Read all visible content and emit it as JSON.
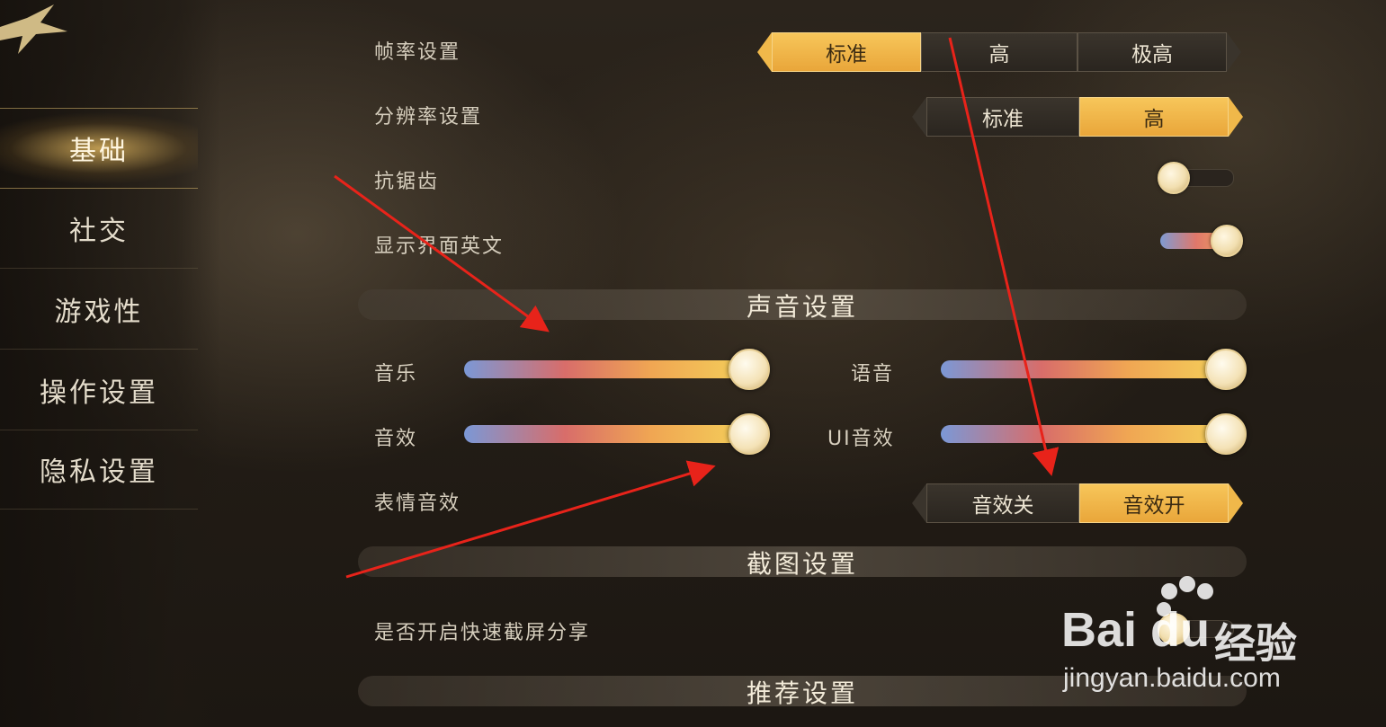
{
  "sidebar": {
    "items": [
      {
        "label": "基础"
      },
      {
        "label": "社交"
      },
      {
        "label": "游戏性"
      },
      {
        "label": "操作设置"
      },
      {
        "label": "隐私设置"
      }
    ],
    "active_index": 0
  },
  "graphics": {
    "frame_rate": {
      "label": "帧率设置",
      "options": [
        "标准",
        "高",
        "极高"
      ],
      "selected": "标准"
    },
    "resolution": {
      "label": "分辨率设置",
      "options": [
        "标准",
        "高"
      ],
      "selected": "高"
    },
    "antialiasing": {
      "label": "抗锯齿",
      "enabled": false
    },
    "show_english_ui": {
      "label": "显示界面英文",
      "enabled": true
    }
  },
  "sound": {
    "section_title": "声音设置",
    "music": {
      "label": "音乐",
      "level": 1.0
    },
    "voice": {
      "label": "语音",
      "level": 1.0
    },
    "sfx": {
      "label": "音效",
      "level": 1.0
    },
    "ui_sfx": {
      "label": "UI音效",
      "level": 1.0
    },
    "emote_sfx": {
      "label": "表情音效",
      "options": [
        "音效关",
        "音效开"
      ],
      "selected": "音效开"
    }
  },
  "screenshot": {
    "section_title": "截图设置",
    "quick_share": {
      "label": "是否开启快速截屏分享",
      "enabled": false
    }
  },
  "recommend": {
    "section_title": "推荐设置"
  },
  "watermark": {
    "brand": "Bai du",
    "cn": "经验",
    "url": "jingyan.baidu.com"
  },
  "colors": {
    "accent": "#f0b84a",
    "annotation_arrow": "#e8231a"
  }
}
